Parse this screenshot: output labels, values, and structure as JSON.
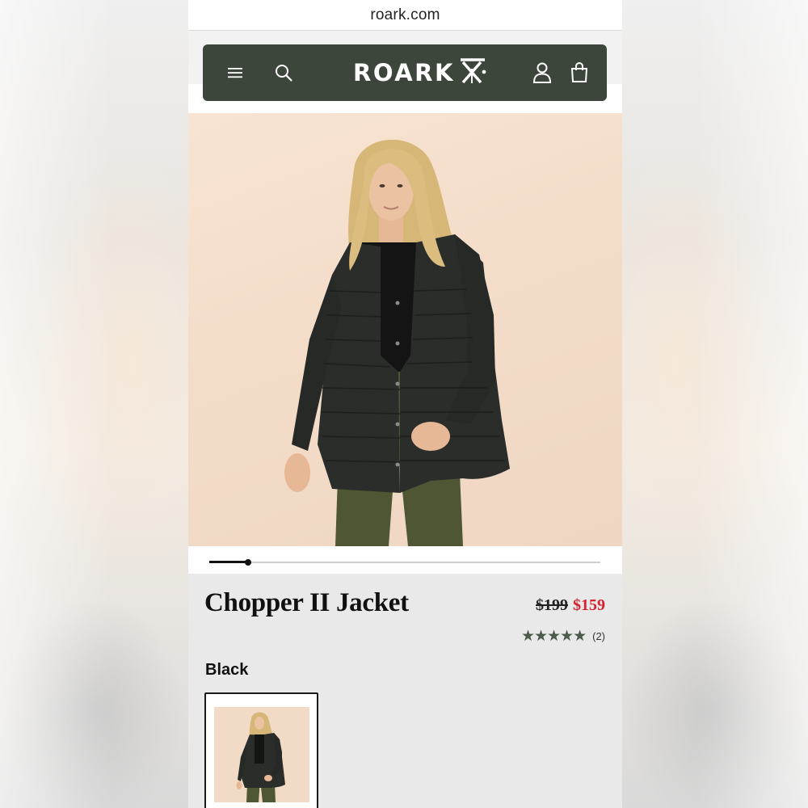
{
  "browser": {
    "url": "roark.com"
  },
  "header": {
    "brand": "ROARK",
    "icons": [
      "hamburger-menu-icon",
      "search-icon",
      "account-icon",
      "shopping-bag-icon"
    ],
    "background_color": "#3c463a"
  },
  "gallery": {
    "current_index": 1,
    "progress": 0.1
  },
  "product": {
    "name": "Chopper II Jacket",
    "original_price": "$199",
    "sale_price": "$159",
    "rating_stars": "★★★★★",
    "rating": 5,
    "review_count": "(2)",
    "selected_color": "Black",
    "colors": [
      "Black"
    ],
    "sale_color": "#d6232f"
  }
}
